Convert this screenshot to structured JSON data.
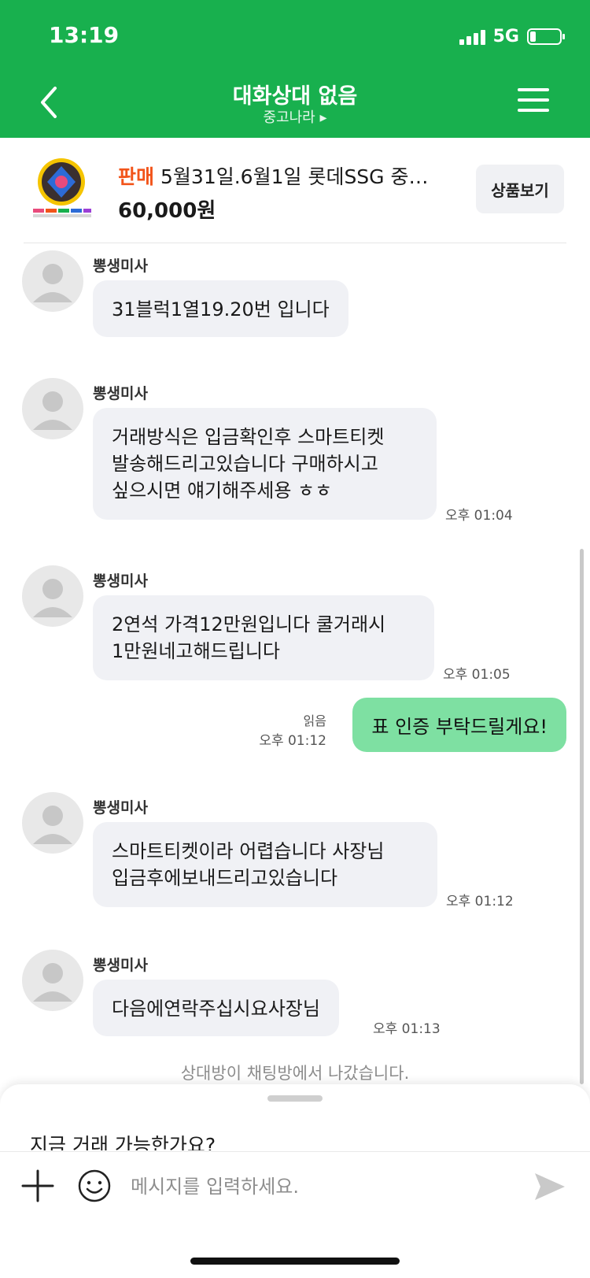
{
  "status_bar": {
    "time": "13:19",
    "network": "5G",
    "battery_level": 0.2
  },
  "header": {
    "title": "대화상대 없음",
    "subtitle": "중고나라 ▸",
    "bg_color": "#18b04e",
    "back_icon": "chevron-left-icon",
    "menu_icon": "hamburger-menu-icon"
  },
  "product": {
    "tag": "판매",
    "title": "5월31일.6월1일  롯데SSG 중…",
    "price": "60,000원",
    "view_button": "상품보기",
    "tag_color": "#f2541a"
  },
  "messages": [
    {
      "sender": "뽕생미사",
      "text": "31블럭1열19.20번 입니다",
      "time": ""
    },
    {
      "sender": "뽕생미사",
      "lines": [
        "거래방식은 입금확인후 스마트티켓",
        "발송해드리고있습니다 구매하시고",
        "싶으시면 얘기해주세용 ㅎㅎ"
      ],
      "time": "오후 01:04"
    },
    {
      "sender": "뽕생미사",
      "lines": [
        "2연석 가격12만원입니다 쿨거래시",
        "1만원네고해드립니다"
      ],
      "time": "오후 01:05"
    },
    {
      "mine": true,
      "text": "표 인증 부탁드릴게요!",
      "read": "읽음",
      "time": "오후 01:12"
    },
    {
      "sender": "뽕생미사",
      "lines": [
        "스마트티켓이라 어렵습니다 사장님",
        "입금후에보내드리고있습니다"
      ],
      "time": "오후 01:12"
    },
    {
      "sender": "뽕생미사",
      "text": "다음에연락주십시요사장님",
      "time": "오후 01:13"
    }
  ],
  "system_message": "상대방이 채팅방에서 나갔습니다.",
  "bottom_sheet": {
    "quick_reply": "지금 거래 가능한가요?",
    "input_placeholder": "메시지를 입력하세요.",
    "plus_icon": "plus-icon",
    "emoji_icon": "smiley-icon",
    "send_icon": "send-icon"
  }
}
